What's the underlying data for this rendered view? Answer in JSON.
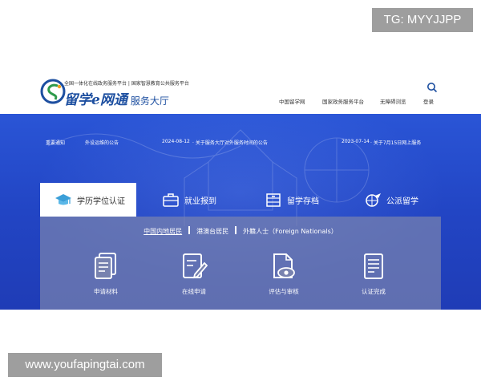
{
  "watermarks": {
    "top": "TG: MYYJJPP",
    "bottom": "www.youfapingtai.com"
  },
  "header": {
    "tagline": "全国一体化在线政务服务平台 | 国家智慧教育公共服务平台",
    "brand_main": "留学e网通",
    "brand_sub": "服务大厅",
    "nav": [
      "中国留学网",
      "国家政务服务平台",
      "无障碍浏览",
      "登录"
    ]
  },
  "notices": {
    "label": "重要通知",
    "items": [
      {
        "title": "外设运维的公告",
        "date": "2024-08-12"
      },
      {
        "title": "关于服务大厅对外服务时间的公告",
        "date": "2023-07-14"
      },
      {
        "title": "关于7月15日网上服务",
        "date": ""
      }
    ]
  },
  "tabs": [
    {
      "label": "学历学位认证",
      "icon": "graduation-cap-icon",
      "active": true
    },
    {
      "label": "就业报到",
      "icon": "briefcase-icon",
      "active": false
    },
    {
      "label": "留学存档",
      "icon": "archive-icon",
      "active": false
    },
    {
      "label": "公派留学",
      "icon": "globe-plane-icon",
      "active": false
    }
  ],
  "subtabs": [
    "中国内地居民",
    "港澳台居民",
    "外籍人士（Foreign Nationals）"
  ],
  "steps": [
    {
      "label": "申请材料",
      "icon": "documents-icon"
    },
    {
      "label": "在线申请",
      "icon": "edit-form-icon"
    },
    {
      "label": "评估与审核",
      "icon": "review-eye-icon"
    },
    {
      "label": "认证完成",
      "icon": "certificate-icon"
    }
  ],
  "colors": {
    "brand": "#1d4fa0",
    "banner": "#2245c4",
    "panel": "#7882af"
  }
}
